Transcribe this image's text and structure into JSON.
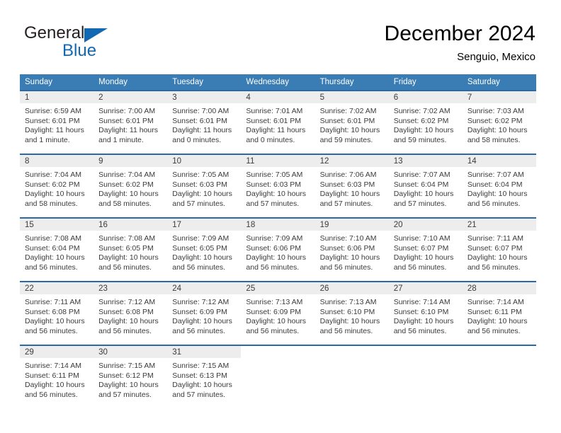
{
  "brand": {
    "name_top": "General",
    "name_bottom": "Blue",
    "triangle_icon": "triangle-icon",
    "accent_color": "#1268b3"
  },
  "header": {
    "title": "December 2024",
    "subtitle": "Senguio, Mexico",
    "header_background": "#3a7cb4",
    "row_divider_color": "#2a6aa8",
    "datenum_band_color": "#ededed"
  },
  "weekday_headers": [
    "Sunday",
    "Monday",
    "Tuesday",
    "Wednesday",
    "Thursday",
    "Friday",
    "Saturday"
  ],
  "weeks": [
    [
      {
        "date": "1",
        "sunrise": "Sunrise: 6:59 AM",
        "sunset": "Sunset: 6:01 PM",
        "daylight_line1": "Daylight: 11 hours",
        "daylight_line2": "and 1 minute."
      },
      {
        "date": "2",
        "sunrise": "Sunrise: 7:00 AM",
        "sunset": "Sunset: 6:01 PM",
        "daylight_line1": "Daylight: 11 hours",
        "daylight_line2": "and 1 minute."
      },
      {
        "date": "3",
        "sunrise": "Sunrise: 7:00 AM",
        "sunset": "Sunset: 6:01 PM",
        "daylight_line1": "Daylight: 11 hours",
        "daylight_line2": "and 0 minutes."
      },
      {
        "date": "4",
        "sunrise": "Sunrise: 7:01 AM",
        "sunset": "Sunset: 6:01 PM",
        "daylight_line1": "Daylight: 11 hours",
        "daylight_line2": "and 0 minutes."
      },
      {
        "date": "5",
        "sunrise": "Sunrise: 7:02 AM",
        "sunset": "Sunset: 6:01 PM",
        "daylight_line1": "Daylight: 10 hours",
        "daylight_line2": "and 59 minutes."
      },
      {
        "date": "6",
        "sunrise": "Sunrise: 7:02 AM",
        "sunset": "Sunset: 6:02 PM",
        "daylight_line1": "Daylight: 10 hours",
        "daylight_line2": "and 59 minutes."
      },
      {
        "date": "7",
        "sunrise": "Sunrise: 7:03 AM",
        "sunset": "Sunset: 6:02 PM",
        "daylight_line1": "Daylight: 10 hours",
        "daylight_line2": "and 58 minutes."
      }
    ],
    [
      {
        "date": "8",
        "sunrise": "Sunrise: 7:04 AM",
        "sunset": "Sunset: 6:02 PM",
        "daylight_line1": "Daylight: 10 hours",
        "daylight_line2": "and 58 minutes."
      },
      {
        "date": "9",
        "sunrise": "Sunrise: 7:04 AM",
        "sunset": "Sunset: 6:02 PM",
        "daylight_line1": "Daylight: 10 hours",
        "daylight_line2": "and 58 minutes."
      },
      {
        "date": "10",
        "sunrise": "Sunrise: 7:05 AM",
        "sunset": "Sunset: 6:03 PM",
        "daylight_line1": "Daylight: 10 hours",
        "daylight_line2": "and 57 minutes."
      },
      {
        "date": "11",
        "sunrise": "Sunrise: 7:05 AM",
        "sunset": "Sunset: 6:03 PM",
        "daylight_line1": "Daylight: 10 hours",
        "daylight_line2": "and 57 minutes."
      },
      {
        "date": "12",
        "sunrise": "Sunrise: 7:06 AM",
        "sunset": "Sunset: 6:03 PM",
        "daylight_line1": "Daylight: 10 hours",
        "daylight_line2": "and 57 minutes."
      },
      {
        "date": "13",
        "sunrise": "Sunrise: 7:07 AM",
        "sunset": "Sunset: 6:04 PM",
        "daylight_line1": "Daylight: 10 hours",
        "daylight_line2": "and 57 minutes."
      },
      {
        "date": "14",
        "sunrise": "Sunrise: 7:07 AM",
        "sunset": "Sunset: 6:04 PM",
        "daylight_line1": "Daylight: 10 hours",
        "daylight_line2": "and 56 minutes."
      }
    ],
    [
      {
        "date": "15",
        "sunrise": "Sunrise: 7:08 AM",
        "sunset": "Sunset: 6:04 PM",
        "daylight_line1": "Daylight: 10 hours",
        "daylight_line2": "and 56 minutes."
      },
      {
        "date": "16",
        "sunrise": "Sunrise: 7:08 AM",
        "sunset": "Sunset: 6:05 PM",
        "daylight_line1": "Daylight: 10 hours",
        "daylight_line2": "and 56 minutes."
      },
      {
        "date": "17",
        "sunrise": "Sunrise: 7:09 AM",
        "sunset": "Sunset: 6:05 PM",
        "daylight_line1": "Daylight: 10 hours",
        "daylight_line2": "and 56 minutes."
      },
      {
        "date": "18",
        "sunrise": "Sunrise: 7:09 AM",
        "sunset": "Sunset: 6:06 PM",
        "daylight_line1": "Daylight: 10 hours",
        "daylight_line2": "and 56 minutes."
      },
      {
        "date": "19",
        "sunrise": "Sunrise: 7:10 AM",
        "sunset": "Sunset: 6:06 PM",
        "daylight_line1": "Daylight: 10 hours",
        "daylight_line2": "and 56 minutes."
      },
      {
        "date": "20",
        "sunrise": "Sunrise: 7:10 AM",
        "sunset": "Sunset: 6:07 PM",
        "daylight_line1": "Daylight: 10 hours",
        "daylight_line2": "and 56 minutes."
      },
      {
        "date": "21",
        "sunrise": "Sunrise: 7:11 AM",
        "sunset": "Sunset: 6:07 PM",
        "daylight_line1": "Daylight: 10 hours",
        "daylight_line2": "and 56 minutes."
      }
    ],
    [
      {
        "date": "22",
        "sunrise": "Sunrise: 7:11 AM",
        "sunset": "Sunset: 6:08 PM",
        "daylight_line1": "Daylight: 10 hours",
        "daylight_line2": "and 56 minutes."
      },
      {
        "date": "23",
        "sunrise": "Sunrise: 7:12 AM",
        "sunset": "Sunset: 6:08 PM",
        "daylight_line1": "Daylight: 10 hours",
        "daylight_line2": "and 56 minutes."
      },
      {
        "date": "24",
        "sunrise": "Sunrise: 7:12 AM",
        "sunset": "Sunset: 6:09 PM",
        "daylight_line1": "Daylight: 10 hours",
        "daylight_line2": "and 56 minutes."
      },
      {
        "date": "25",
        "sunrise": "Sunrise: 7:13 AM",
        "sunset": "Sunset: 6:09 PM",
        "daylight_line1": "Daylight: 10 hours",
        "daylight_line2": "and 56 minutes."
      },
      {
        "date": "26",
        "sunrise": "Sunrise: 7:13 AM",
        "sunset": "Sunset: 6:10 PM",
        "daylight_line1": "Daylight: 10 hours",
        "daylight_line2": "and 56 minutes."
      },
      {
        "date": "27",
        "sunrise": "Sunrise: 7:14 AM",
        "sunset": "Sunset: 6:10 PM",
        "daylight_line1": "Daylight: 10 hours",
        "daylight_line2": "and 56 minutes."
      },
      {
        "date": "28",
        "sunrise": "Sunrise: 7:14 AM",
        "sunset": "Sunset: 6:11 PM",
        "daylight_line1": "Daylight: 10 hours",
        "daylight_line2": "and 56 minutes."
      }
    ],
    [
      {
        "date": "29",
        "sunrise": "Sunrise: 7:14 AM",
        "sunset": "Sunset: 6:11 PM",
        "daylight_line1": "Daylight: 10 hours",
        "daylight_line2": "and 56 minutes."
      },
      {
        "date": "30",
        "sunrise": "Sunrise: 7:15 AM",
        "sunset": "Sunset: 6:12 PM",
        "daylight_line1": "Daylight: 10 hours",
        "daylight_line2": "and 57 minutes."
      },
      {
        "date": "31",
        "sunrise": "Sunrise: 7:15 AM",
        "sunset": "Sunset: 6:13 PM",
        "daylight_line1": "Daylight: 10 hours",
        "daylight_line2": "and 57 minutes."
      },
      {
        "date": "",
        "sunrise": "",
        "sunset": "",
        "daylight_line1": "",
        "daylight_line2": ""
      },
      {
        "date": "",
        "sunrise": "",
        "sunset": "",
        "daylight_line1": "",
        "daylight_line2": ""
      },
      {
        "date": "",
        "sunrise": "",
        "sunset": "",
        "daylight_line1": "",
        "daylight_line2": ""
      },
      {
        "date": "",
        "sunrise": "",
        "sunset": "",
        "daylight_line1": "",
        "daylight_line2": ""
      }
    ]
  ]
}
